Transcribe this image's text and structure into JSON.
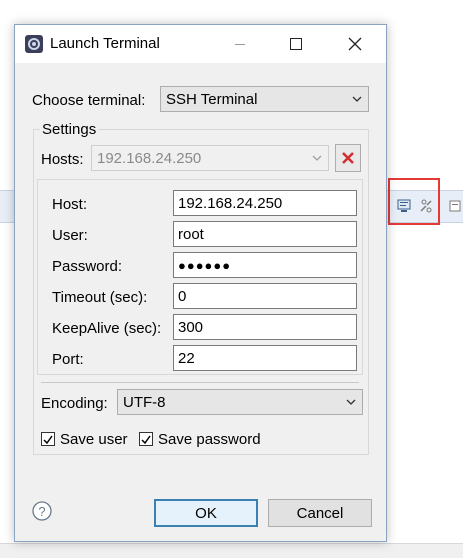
{
  "window": {
    "title": "Launch Terminal"
  },
  "choose_terminal": {
    "label": "Choose terminal:",
    "value": "SSH Terminal"
  },
  "settings": {
    "group_label": "Settings",
    "hosts_label": "Hosts:",
    "hosts_value": "192.168.24.250",
    "fields": {
      "host": {
        "label": "Host:",
        "value": "192.168.24.250"
      },
      "user": {
        "label": "User:",
        "value": "root"
      },
      "password": {
        "label": "Password:",
        "value": "●●●●●●"
      },
      "timeout": {
        "label": "Timeout (sec):",
        "value": "0"
      },
      "keepalive": {
        "label": "KeepAlive (sec):",
        "value": "300"
      },
      "port": {
        "label": "Port:",
        "value": "22"
      }
    },
    "encoding_label": "Encoding:",
    "encoding_value": "UTF-8",
    "save_user": {
      "label": "Save user",
      "checked": true
    },
    "save_password": {
      "label": "Save password",
      "checked": true
    }
  },
  "buttons": {
    "ok": "OK",
    "cancel": "Cancel"
  },
  "colors": {
    "accent": "#3c7fb1",
    "highlight": "#e53935",
    "delete": "#d32f2f"
  }
}
